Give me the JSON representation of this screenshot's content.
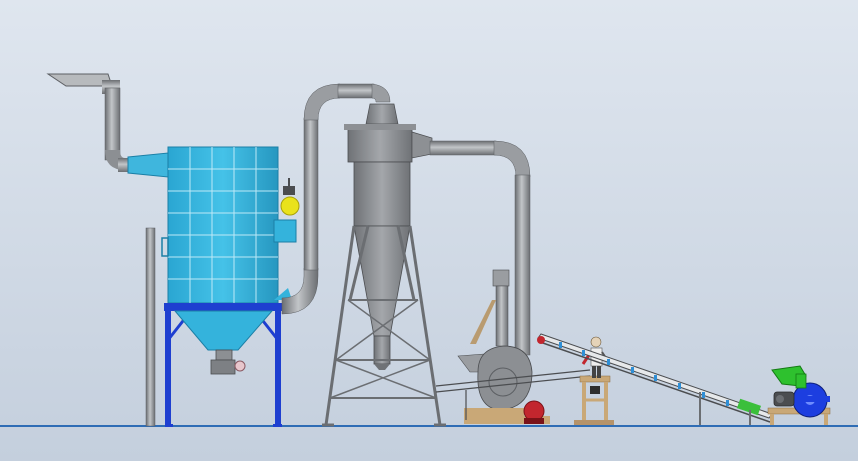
{
  "scene": {
    "kind": "cad-assembly-side-view",
    "components": [
      "exhaust-duct",
      "bag-filter-dust-collector",
      "filter-support-frame",
      "collector-hopper",
      "rotary-airlock",
      "explosion-vent",
      "standalone-post",
      "connecting-duct",
      "cyclone-separator",
      "cyclone-support-tower",
      "cyclone-outlet-duct",
      "centrifugal-fan",
      "fan-motor",
      "operator-figure",
      "operator-platform",
      "belt-conveyor",
      "hammer-mill",
      "mill-motor",
      "mill-feed-hopper"
    ]
  },
  "colors": {
    "background_top": "#dfe6ef",
    "background_bottom": "#c4cfdd",
    "ground_line": "#2f6db5",
    "steel": "#8c8f93",
    "steel_light": "#b9bcc0",
    "steel_dark": "#5c5f63",
    "filter_body": "#34b3dc",
    "filter_grid": "#bde9f7",
    "frame_blue": "#1e3fd0",
    "yellow_vent": "#e9e21b",
    "fan_motor_red": "#c2262e",
    "mill_blue": "#1c3ee0",
    "mill_green": "#2ec12e",
    "wood": "#c9a877"
  }
}
